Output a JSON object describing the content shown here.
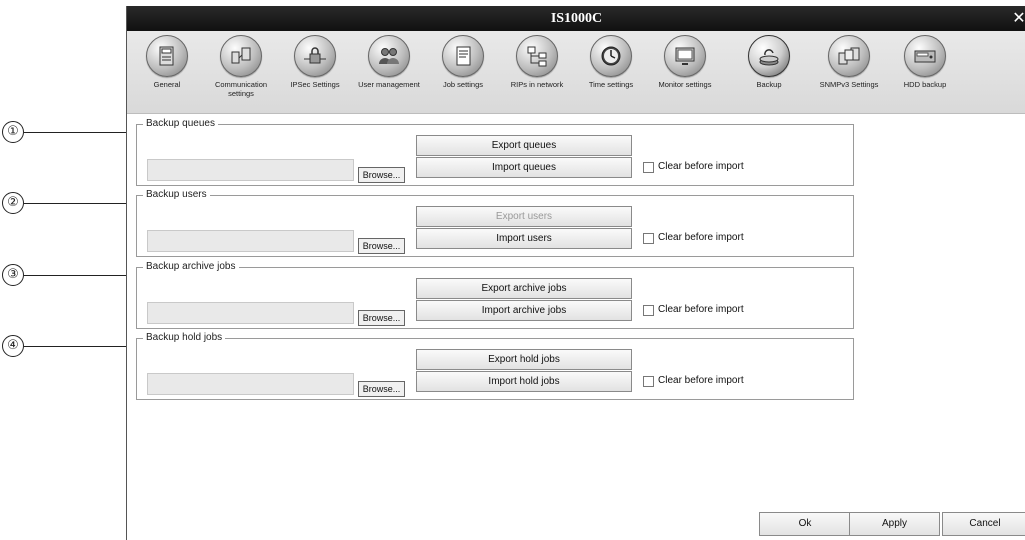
{
  "window": {
    "title": "IS1000C",
    "close_glyph": "✕"
  },
  "callouts": [
    "①",
    "②",
    "③",
    "④"
  ],
  "toolbar": {
    "items": [
      {
        "label": "General",
        "icon": "rip-server-icon"
      },
      {
        "label": "Communication settings",
        "icon": "network-computers-icon"
      },
      {
        "label": "IPSec Settings",
        "icon": "lock-network-icon"
      },
      {
        "label": "User management",
        "icon": "users-icon"
      },
      {
        "label": "Job settings",
        "icon": "document-icon"
      },
      {
        "label": "RIPs in network",
        "icon": "network-tree-icon"
      },
      {
        "label": "Time settings",
        "icon": "clock-icon"
      },
      {
        "label": "Monitor settings",
        "icon": "monitor-icon"
      },
      {
        "label": "Backup",
        "icon": "backup-icon",
        "active": true
      },
      {
        "label": "SNMPv3 Settings",
        "icon": "snmp-computers-icon"
      },
      {
        "label": "HDD backup",
        "icon": "hdd-icon"
      }
    ]
  },
  "groups": [
    {
      "legend": "Backup queues",
      "export_label": "Export queues",
      "import_label": "Import queues",
      "browse_label": "Browse...",
      "clear_label": "Clear before import",
      "export_disabled": false
    },
    {
      "legend": "Backup users",
      "export_label": "Export users",
      "import_label": "Import users",
      "browse_label": "Browse...",
      "clear_label": "Clear before import",
      "export_disabled": true
    },
    {
      "legend": "Backup archive jobs",
      "export_label": "Export archive jobs",
      "import_label": "Import archive jobs",
      "browse_label": "Browse...",
      "clear_label": "Clear before import",
      "export_disabled": false
    },
    {
      "legend": "Backup hold jobs",
      "export_label": "Export hold jobs",
      "import_label": "Import hold jobs",
      "browse_label": "Browse...",
      "clear_label": "Clear before import",
      "export_disabled": false
    }
  ],
  "footer": {
    "ok_label": "Ok",
    "apply_label": "Apply",
    "cancel_label": "Cancel"
  }
}
